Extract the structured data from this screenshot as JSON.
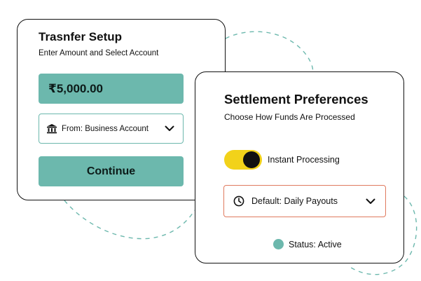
{
  "colors": {
    "accent": "#6cb8ad",
    "toggle_on": "#f2d21a",
    "dropdown_border": "#e07a5f",
    "card_border": "#111111"
  },
  "transfer": {
    "title": "Trasnfer Setup",
    "subtitle": "Enter Amount and Select Account",
    "amount_value": "₹5,000.00",
    "account_select": {
      "icon": "bank-icon",
      "selected": "From: Business Account",
      "chevron_icon": "chevron-down-icon"
    },
    "continue_label": "Continue"
  },
  "settlement": {
    "title": "Settlement Preferences",
    "subtitle": "Choose How Funds Are Processed",
    "toggle": {
      "label": "Instant Processing",
      "state": "on"
    },
    "schedule_select": {
      "icon": "clock-icon",
      "selected": "Default: Daily Payouts",
      "chevron_icon": "chevron-down-icon"
    },
    "status": {
      "label": "Status: Active",
      "color": "#6cb8ad"
    }
  }
}
